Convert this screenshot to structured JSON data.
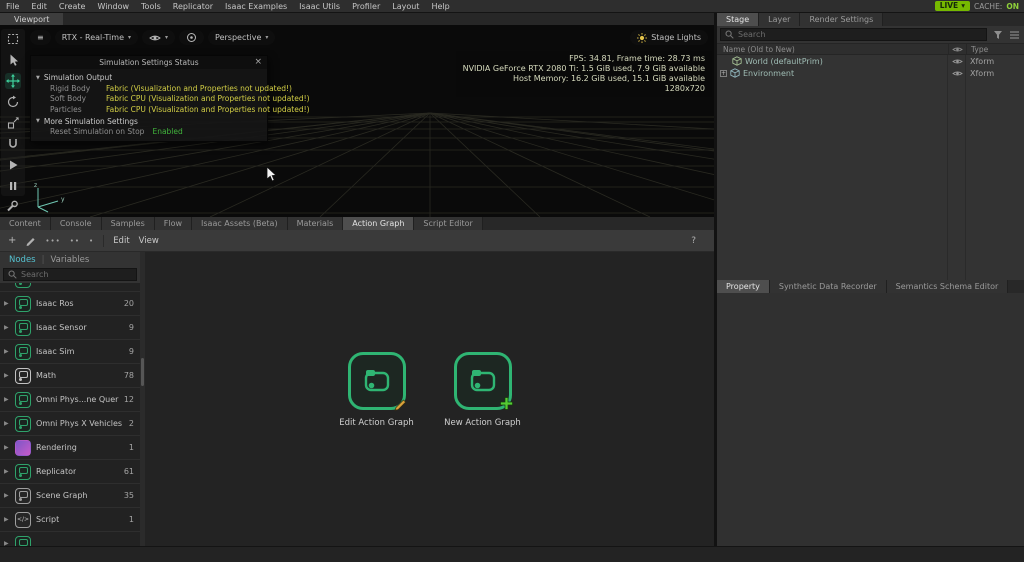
{
  "menubar": {
    "items": [
      "File",
      "Edit",
      "Create",
      "Window",
      "Tools",
      "Replicator",
      "Isaac Examples",
      "Isaac Utils",
      "Profiler",
      "Layout",
      "Help"
    ],
    "live_label": "LIVE",
    "cache_label": "CACHE:",
    "cache_state": "ON"
  },
  "viewport": {
    "tab_label": "Viewport",
    "renderer_label": "RTX - Real-Time",
    "camera_label": "Perspective",
    "stage_lights_label": "Stage Lights",
    "hud": {
      "line1": "FPS: 34.81, Frame time: 28.73 ms",
      "line2": "NVIDIA GeForce RTX 2080 Ti: 1.5 GiB used, 7.9 GiB available",
      "line3": "Host Memory: 16.2 GiB used, 15.1 GiB available",
      "line4": "1280x720"
    },
    "axis": {
      "up": "z",
      "right": "y"
    },
    "sim_panel": {
      "title": "Simulation Settings Status",
      "section_output": "Simulation Output",
      "rows": [
        {
          "label": "Rigid Body",
          "value": "Fabric (Visualization and Properties not updated!)"
        },
        {
          "label": "Soft Body",
          "value": "Fabric CPU (Visualization and Properties not updated!)"
        },
        {
          "label": "Particles",
          "value": "Fabric CPU (Visualization and Properties not updated!)"
        }
      ],
      "section_more": "More Simulation Settings",
      "reset_label": "Reset Simulation on Stop",
      "reset_value": "Enabled"
    }
  },
  "bottom_panel": {
    "tabs": [
      "Content",
      "Console",
      "Samples",
      "Flow",
      "Isaac Assets (Beta)",
      "Materials",
      "Action Graph",
      "Script Editor"
    ],
    "menus": {
      "edit": "Edit",
      "view": "View"
    },
    "subtabs": {
      "nodes": "Nodes",
      "variables": "Variables"
    },
    "search_placeholder": "Search",
    "categories": [
      {
        "name": "Isaac Ros",
        "count": 20
      },
      {
        "name": "Isaac Sensor",
        "count": 9
      },
      {
        "name": "Isaac Sim",
        "count": 9
      },
      {
        "name": "Math",
        "count": 78
      },
      {
        "name": "Omni Phys...ne Queries",
        "count": 12
      },
      {
        "name": "Omni Phys X Vehicles",
        "count": 2
      },
      {
        "name": "Rendering",
        "count": 1
      },
      {
        "name": "Replicator",
        "count": 61
      },
      {
        "name": "Scene Graph",
        "count": 35
      },
      {
        "name": "Script",
        "count": 1
      }
    ],
    "actions": {
      "edit": "Edit Action Graph",
      "new": "New Action Graph"
    },
    "help_label": "?"
  },
  "right_panel": {
    "tabs": [
      "Stage",
      "Layer",
      "Render Settings"
    ],
    "search_placeholder": "Search",
    "columns": {
      "name": "Name (Old to New)",
      "type": "Type"
    },
    "rows": [
      {
        "name": "World (defaultPrim)",
        "type": "Xform"
      },
      {
        "name": "Environment",
        "type": "Xform"
      }
    ],
    "property_tabs": [
      "Property",
      "Synthetic Data Recorder",
      "Semantics Schema Editor"
    ]
  },
  "icons": {
    "hamburger": "≡",
    "dropdown": "▾",
    "collapse": "▼",
    "chevron": "▶",
    "close": "×",
    "plus": "+",
    "dots3": "•••",
    "dots2": "••",
    "dot1": "•",
    "separator": "|",
    "expander_plus": "+"
  }
}
